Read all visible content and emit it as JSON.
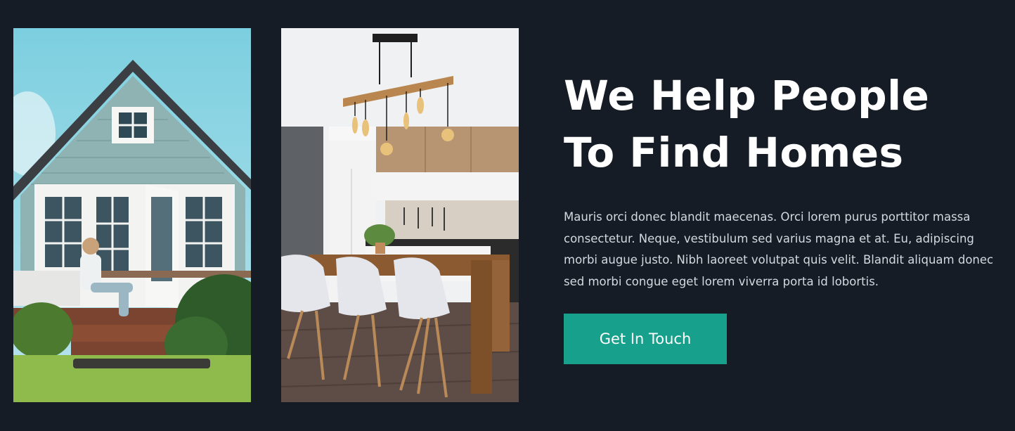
{
  "hero": {
    "headline_line1": "We Help People",
    "headline_line2": "To Find Homes",
    "body": "Mauris orci donec blandit maecenas. Orci lorem purus porttitor massa consectetur. Neque, vestibulum sed varius magna et at. Eu, adipiscing morbi augue justo. Nibh laoreet volutpat quis velit. Blandit aliquam donec sed morbi congue eget lorem viverra porta id lobortis.",
    "cta_label": "Get In Touch"
  },
  "colors": {
    "background": "#161c26",
    "accent": "#17a08b",
    "text": "#ffffff"
  }
}
